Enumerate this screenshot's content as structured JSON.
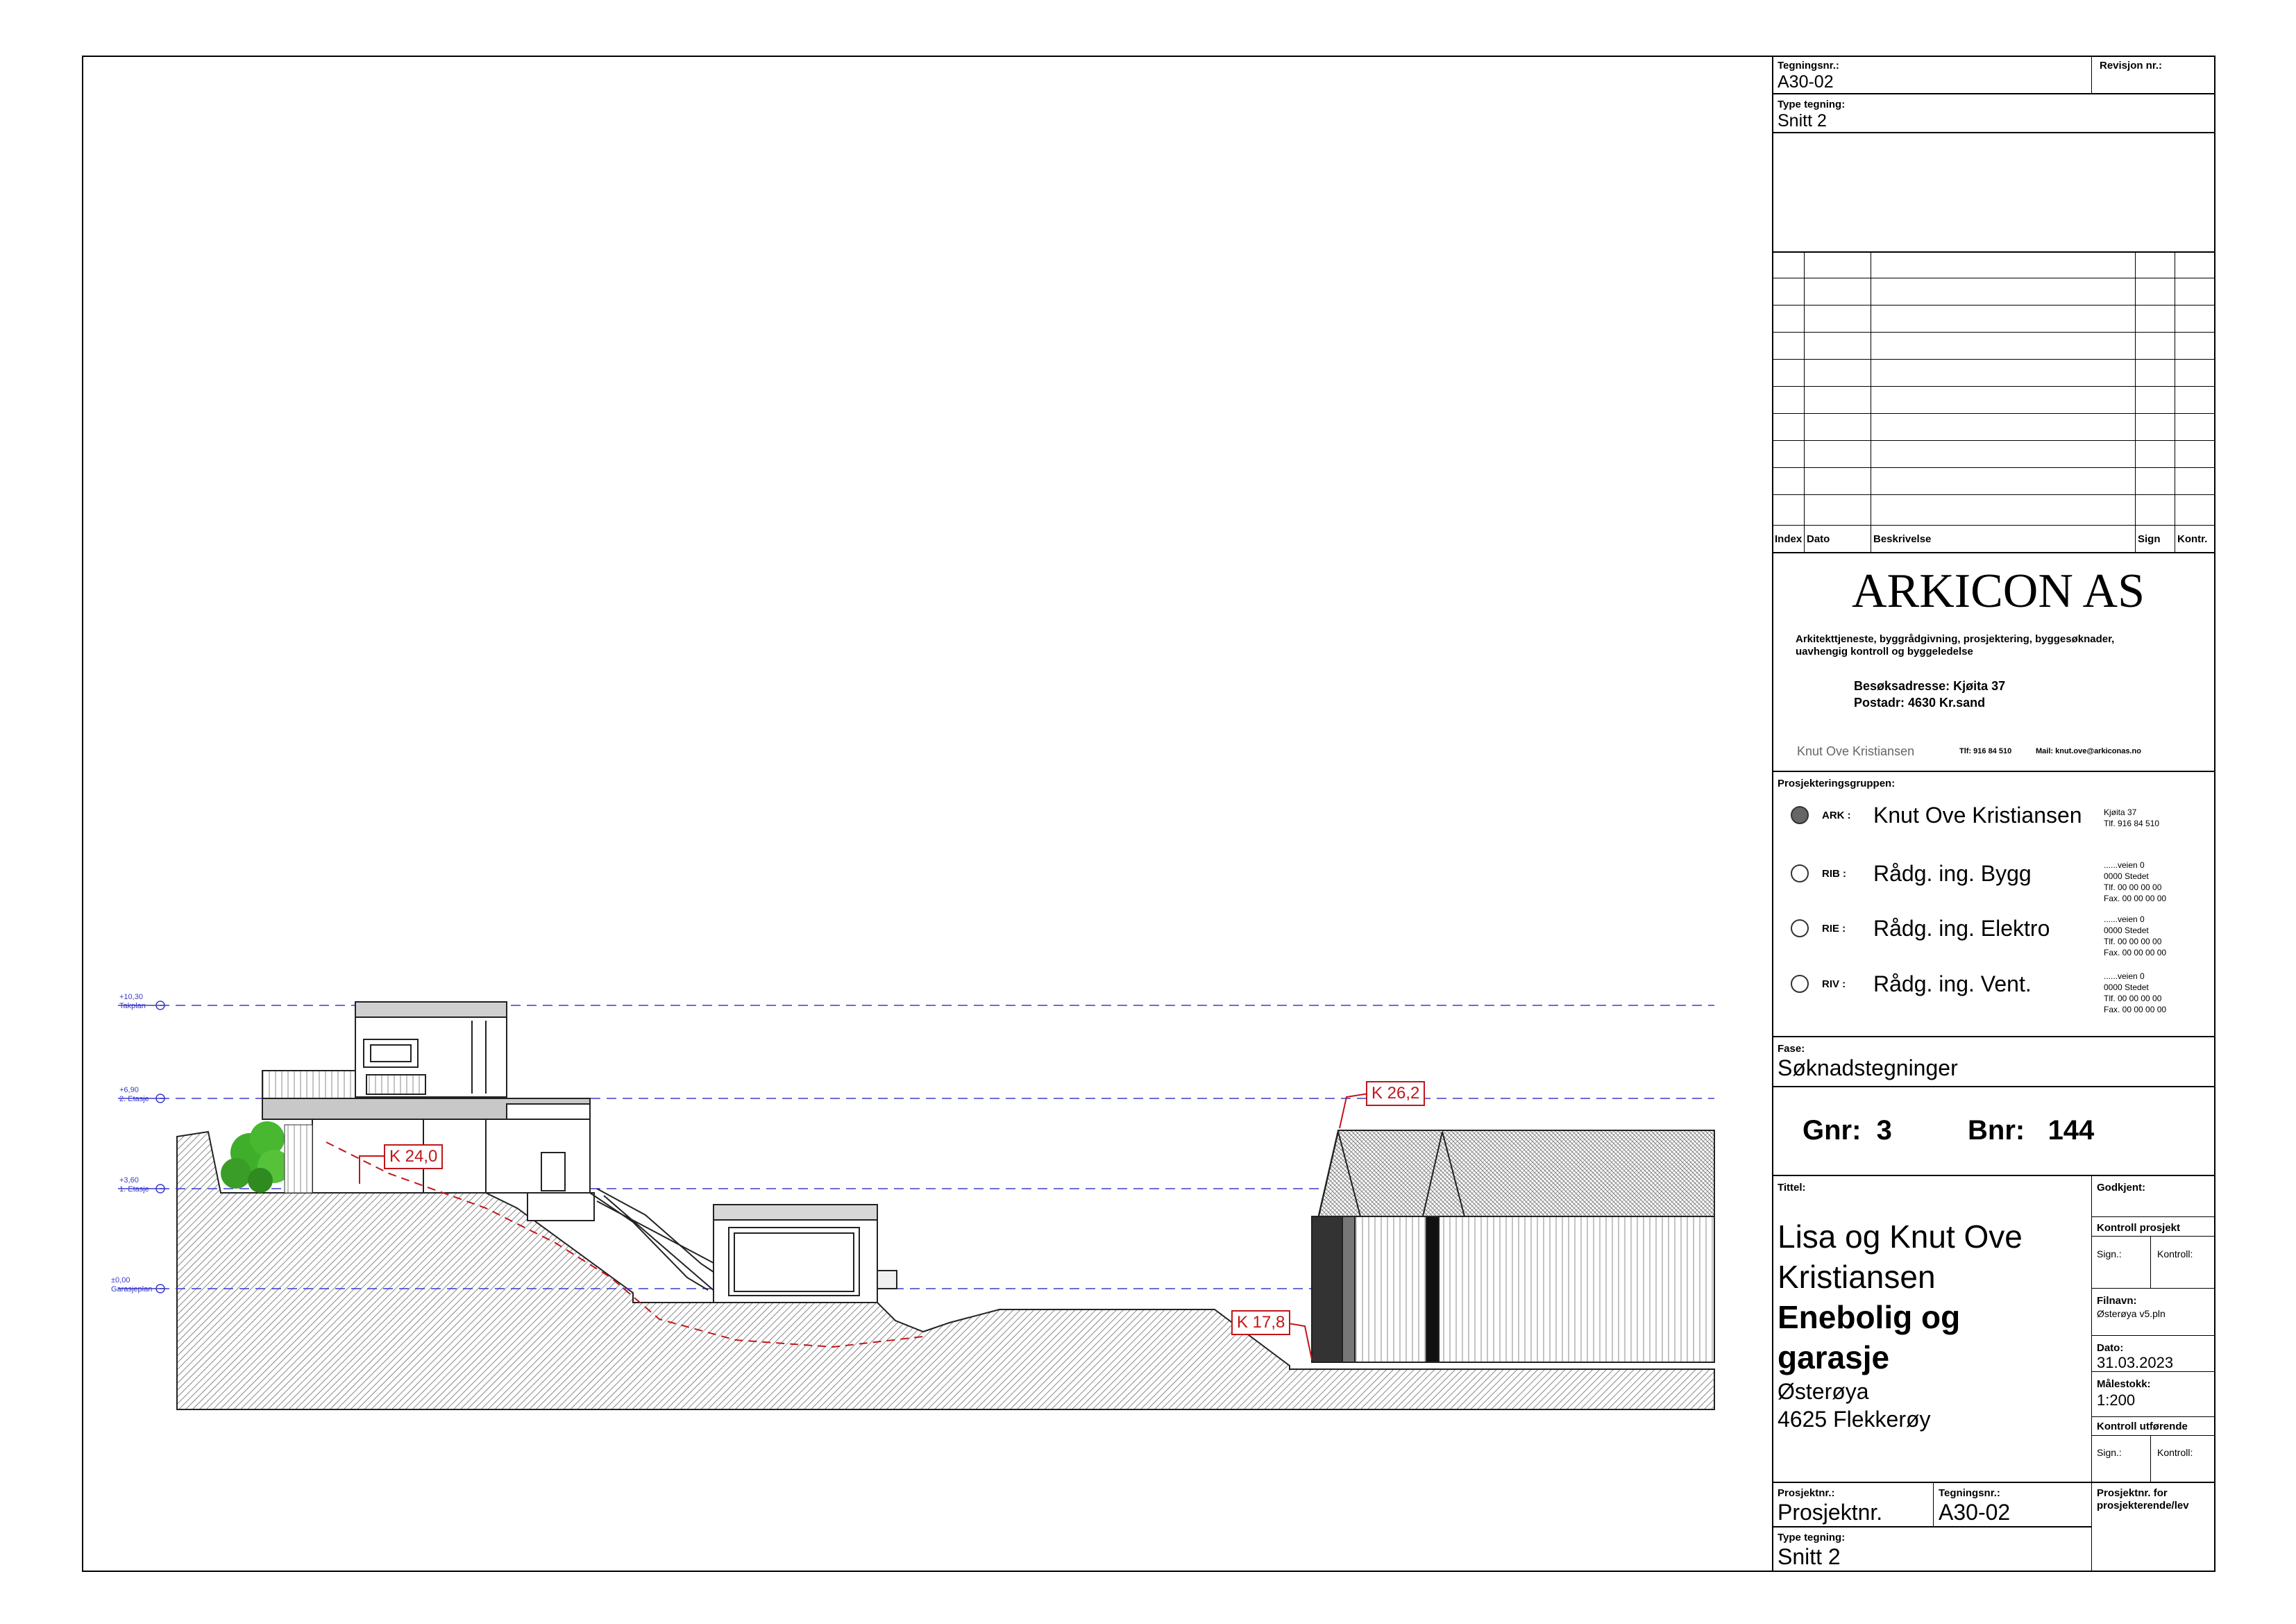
{
  "title_block": {
    "tegningsnr_label": "Tegningsnr.:",
    "tegningsnr_value": "A30-02",
    "revisjon_label": "Revisjon nr.:",
    "type_label": "Type tegning:",
    "type_value": "Snitt 2",
    "rev_headers": {
      "index": "Index",
      "dato": "Dato",
      "beskrivelse": "Beskrivelse",
      "sign": "Sign",
      "kontr": "Kontr."
    },
    "company": {
      "name": "ARKICON AS",
      "services": "Arkitekttjeneste, byggrådgivning, prosjektering, byggesøknader,",
      "services2": "uavhengig kontroll og byggeledelse",
      "visit": "Besøksadresse: Kjøita 37",
      "post": "Postadr: 4630 Kr.sand",
      "contact_name": "Knut Ove Kristiansen",
      "phone": "Tlf: 916 84 510",
      "mail": "Mail: knut.ove@arkiconas.no"
    },
    "group_label": "Prosjekteringsgruppen:",
    "group": [
      {
        "code": "ARK :",
        "name": "Knut Ove Kristiansen",
        "addr": [
          "Kjøita 37",
          "Tlf. 916 84 510"
        ],
        "filled": true
      },
      {
        "code": "RIB :",
        "name": "Rådg. ing. Bygg",
        "addr": [
          "......veien 0",
          "0000 Stedet",
          "Tlf. 00 00 00 00",
          "Fax. 00 00 00 00"
        ],
        "filled": false
      },
      {
        "code": "RIE :",
        "name": "Rådg. ing. Elektro",
        "addr": [
          "......veien 0",
          "0000 Stedet",
          "Tlf. 00 00 00 00",
          "Fax. 00 00 00 00"
        ],
        "filled": false
      },
      {
        "code": "RIV :",
        "name": "Rådg. ing. Vent.",
        "addr": [
          "......veien 0",
          "0000 Stedet",
          "Tlf. 00 00 00 00",
          "Fax. 00 00 00 00"
        ],
        "filled": false
      }
    ],
    "fase_label": "Fase:",
    "fase_value": "Søknadstegninger",
    "gnr_label": "Gnr:",
    "gnr_value": "3",
    "bnr_label": "Bnr:",
    "bnr_value": "144",
    "tittel_label": "Tittel:",
    "title_line1": "Lisa og Knut Ove",
    "title_line2": "Kristiansen",
    "title_line3": "Enebolig og",
    "title_line4": "garasje",
    "title_line5": "Østerøya",
    "title_line6": "4625 Flekkerøy",
    "godkjent_label": "Godkjent:",
    "kontroll_prosjekt": "Kontroll prosjekt",
    "sign_label": "Sign.:",
    "kontroll_label": "Kontroll:",
    "filnavn_label": "Filnavn:",
    "filnavn_value": "Østerøya v5.pln",
    "dato_label": "Dato:",
    "dato_value": "31.03.2023",
    "malestokk_label": "Målestokk:",
    "malestokk_value": "1:200",
    "kontroll_utforende": "Kontroll utførende",
    "prosjektnr_label": "Prosjektnr.:",
    "prosjektnr_value": "Prosjektnr.",
    "tegningsnr2_label": "Tegningsnr.:",
    "tegningsnr2_value": "A30-02",
    "prosjektnr_for": "Prosjektnr. for",
    "prosjektnr_for2": "prosjekterende/lev",
    "type2_label": "Type tegning:",
    "type2_value": "Snitt 2"
  },
  "drawing": {
    "levels": [
      {
        "value": "+10,30",
        "name": "Takplan"
      },
      {
        "value": "+6,90",
        "name": "2. Etasje"
      },
      {
        "value": "+3,60",
        "name": "1. Etasje"
      },
      {
        "value": "±0,00",
        "name": "Garasjeplan"
      }
    ],
    "callouts": [
      "K 24,0",
      "K 26,2",
      "K 17,8"
    ],
    "accent_color": "#c0161b",
    "level_line_color": "#3a3acb"
  }
}
